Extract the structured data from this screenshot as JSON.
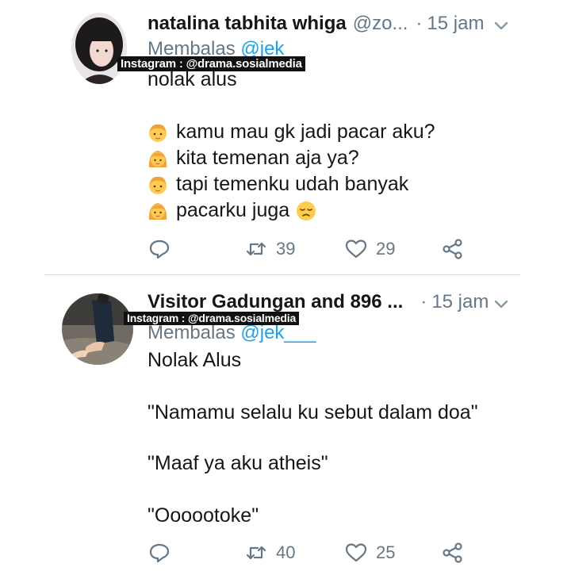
{
  "watermark": "Instagram : @drama.sosialmedia",
  "tweets": [
    {
      "display_name": "natalina tabhita whiga",
      "handle": "@zo...",
      "separator": "·",
      "time": "15 jam",
      "reply_prefix": "Membalas",
      "reply_mention": "@jek",
      "lines": [
        "nolak alus",
        "kamu mau gk jadi pacar aku?",
        "kita temenan aja ya?",
        "tapi temenku udah banyak",
        "pacarku juga"
      ],
      "retweets": "39",
      "likes": "29"
    },
    {
      "display_name": "Visitor Gadungan and 896 ...",
      "separator": "·",
      "time": "15 jam",
      "reply_prefix": "Membalas",
      "reply_mention": "@jek___",
      "lines": [
        "Nolak Alus",
        "\"Namamu selalu ku sebut dalam doa\"",
        "\"Maaf ya aku atheis\"",
        "\"Oooootoke\""
      ],
      "retweets": "40",
      "likes": "25"
    }
  ],
  "colors": {
    "text": "#14171a",
    "secondary": "#657786",
    "mention": "#1da1f2",
    "divider": "#d8dee3"
  },
  "icons": [
    "chevron-down-icon",
    "reply-icon",
    "retweet-icon",
    "like-icon",
    "share-icon",
    "boy-emoji",
    "girl-emoji",
    "disappointed-emoji"
  ]
}
